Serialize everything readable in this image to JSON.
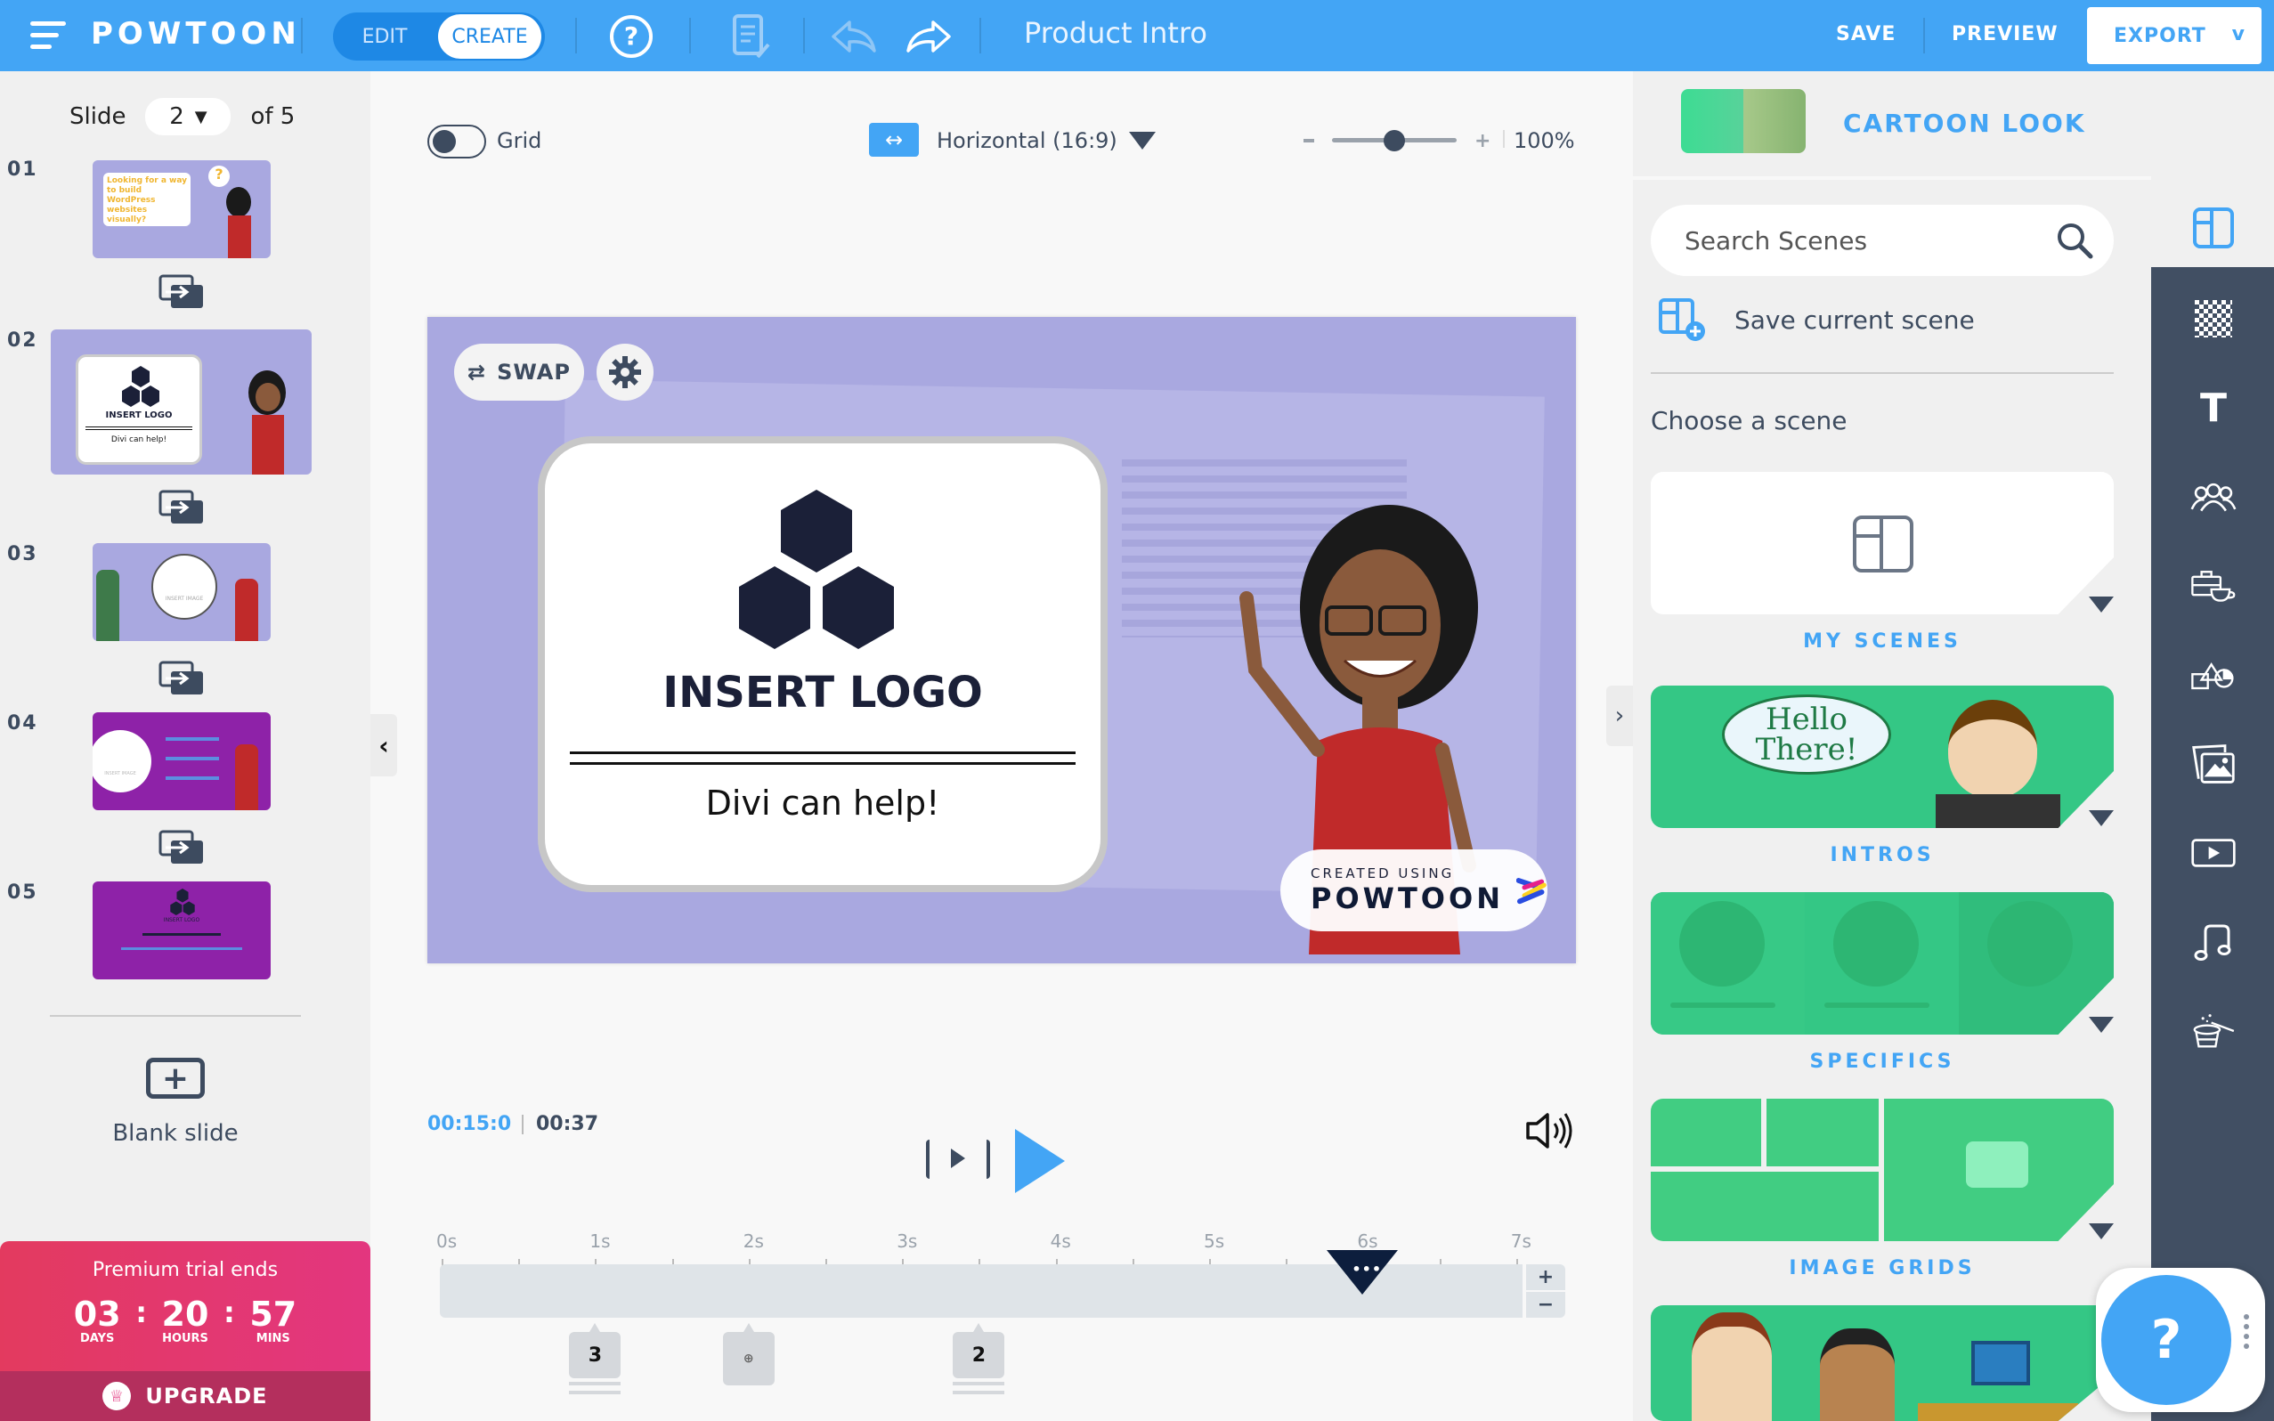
{
  "topbar": {
    "logo": "POWTOON",
    "mode_edit": "EDIT",
    "mode_create": "CREATE",
    "project_title": "Product Intro",
    "save": "SAVE",
    "preview": "PREVIEW",
    "export": "EXPORT",
    "export_chevron": "v",
    "accent_color": "#43a5f5"
  },
  "slides": {
    "label": "Slide",
    "current": "2",
    "of_label": "of 5",
    "items": [
      {
        "number": "01",
        "text": "Looking for a way to build WordPress websites visually?"
      },
      {
        "number": "02",
        "text": "INSERT LOGO",
        "subtext": "Divi can help!"
      },
      {
        "number": "03",
        "text": "INSERT IMAGE"
      },
      {
        "number": "04",
        "text": "INSERT IMAGE"
      },
      {
        "number": "05",
        "text": "INSERT LOGO"
      }
    ],
    "blank_slide": "Blank slide"
  },
  "trial": {
    "title": "Premium trial ends",
    "days": "03",
    "days_label": "DAYS",
    "hours": "20",
    "hours_label": "HOURS",
    "mins": "57",
    "mins_label": "MINS",
    "upgrade": "UPGRADE"
  },
  "canvas_toolbar": {
    "grid_label": "Grid",
    "grid_on": false,
    "orientation": "Horizontal (16:9)",
    "zoom_value": "100%",
    "zoom_slider_fraction": 0.5
  },
  "canvas": {
    "swap": "SWAP",
    "insert_logo": "INSERT LOGO",
    "subtitle": "Divi can help!",
    "watermark_small": "CREATED USING",
    "watermark_big": "POWTOON"
  },
  "playback": {
    "current_time": "00:15:0",
    "total_time": "00:37",
    "timeline_labels": [
      "0s",
      "1s",
      "2s",
      "3s",
      "4s",
      "5s",
      "6s",
      "7s"
    ],
    "playhead_seconds": 6,
    "playhead_glyph": "•••",
    "zoom_in": "+",
    "zoom_out": "−",
    "markers": [
      {
        "label": "3",
        "seconds": 1
      },
      {
        "label": "",
        "seconds": 2
      },
      {
        "label": "2",
        "seconds": 3.5
      }
    ]
  },
  "right_panel": {
    "style_name": "CARTOON LOOK",
    "search_placeholder": "Search Scenes",
    "save_scene": "Save current scene",
    "choose_scene": "Choose a scene",
    "categories": [
      {
        "label": "MY SCENES"
      },
      {
        "label": "INTROS",
        "bubble": "Hello There!"
      },
      {
        "label": "SPECIFICS"
      },
      {
        "label": "IMAGE GRIDS"
      }
    ]
  },
  "toolbar_right": {
    "tools": [
      "scenes-icon",
      "backgrounds-icon",
      "text-icon",
      "characters-icon",
      "props-icon",
      "shapes-icon",
      "images-icon",
      "video-icon",
      "music-icon",
      "magic-icon"
    ]
  },
  "help": {
    "label": "?"
  }
}
